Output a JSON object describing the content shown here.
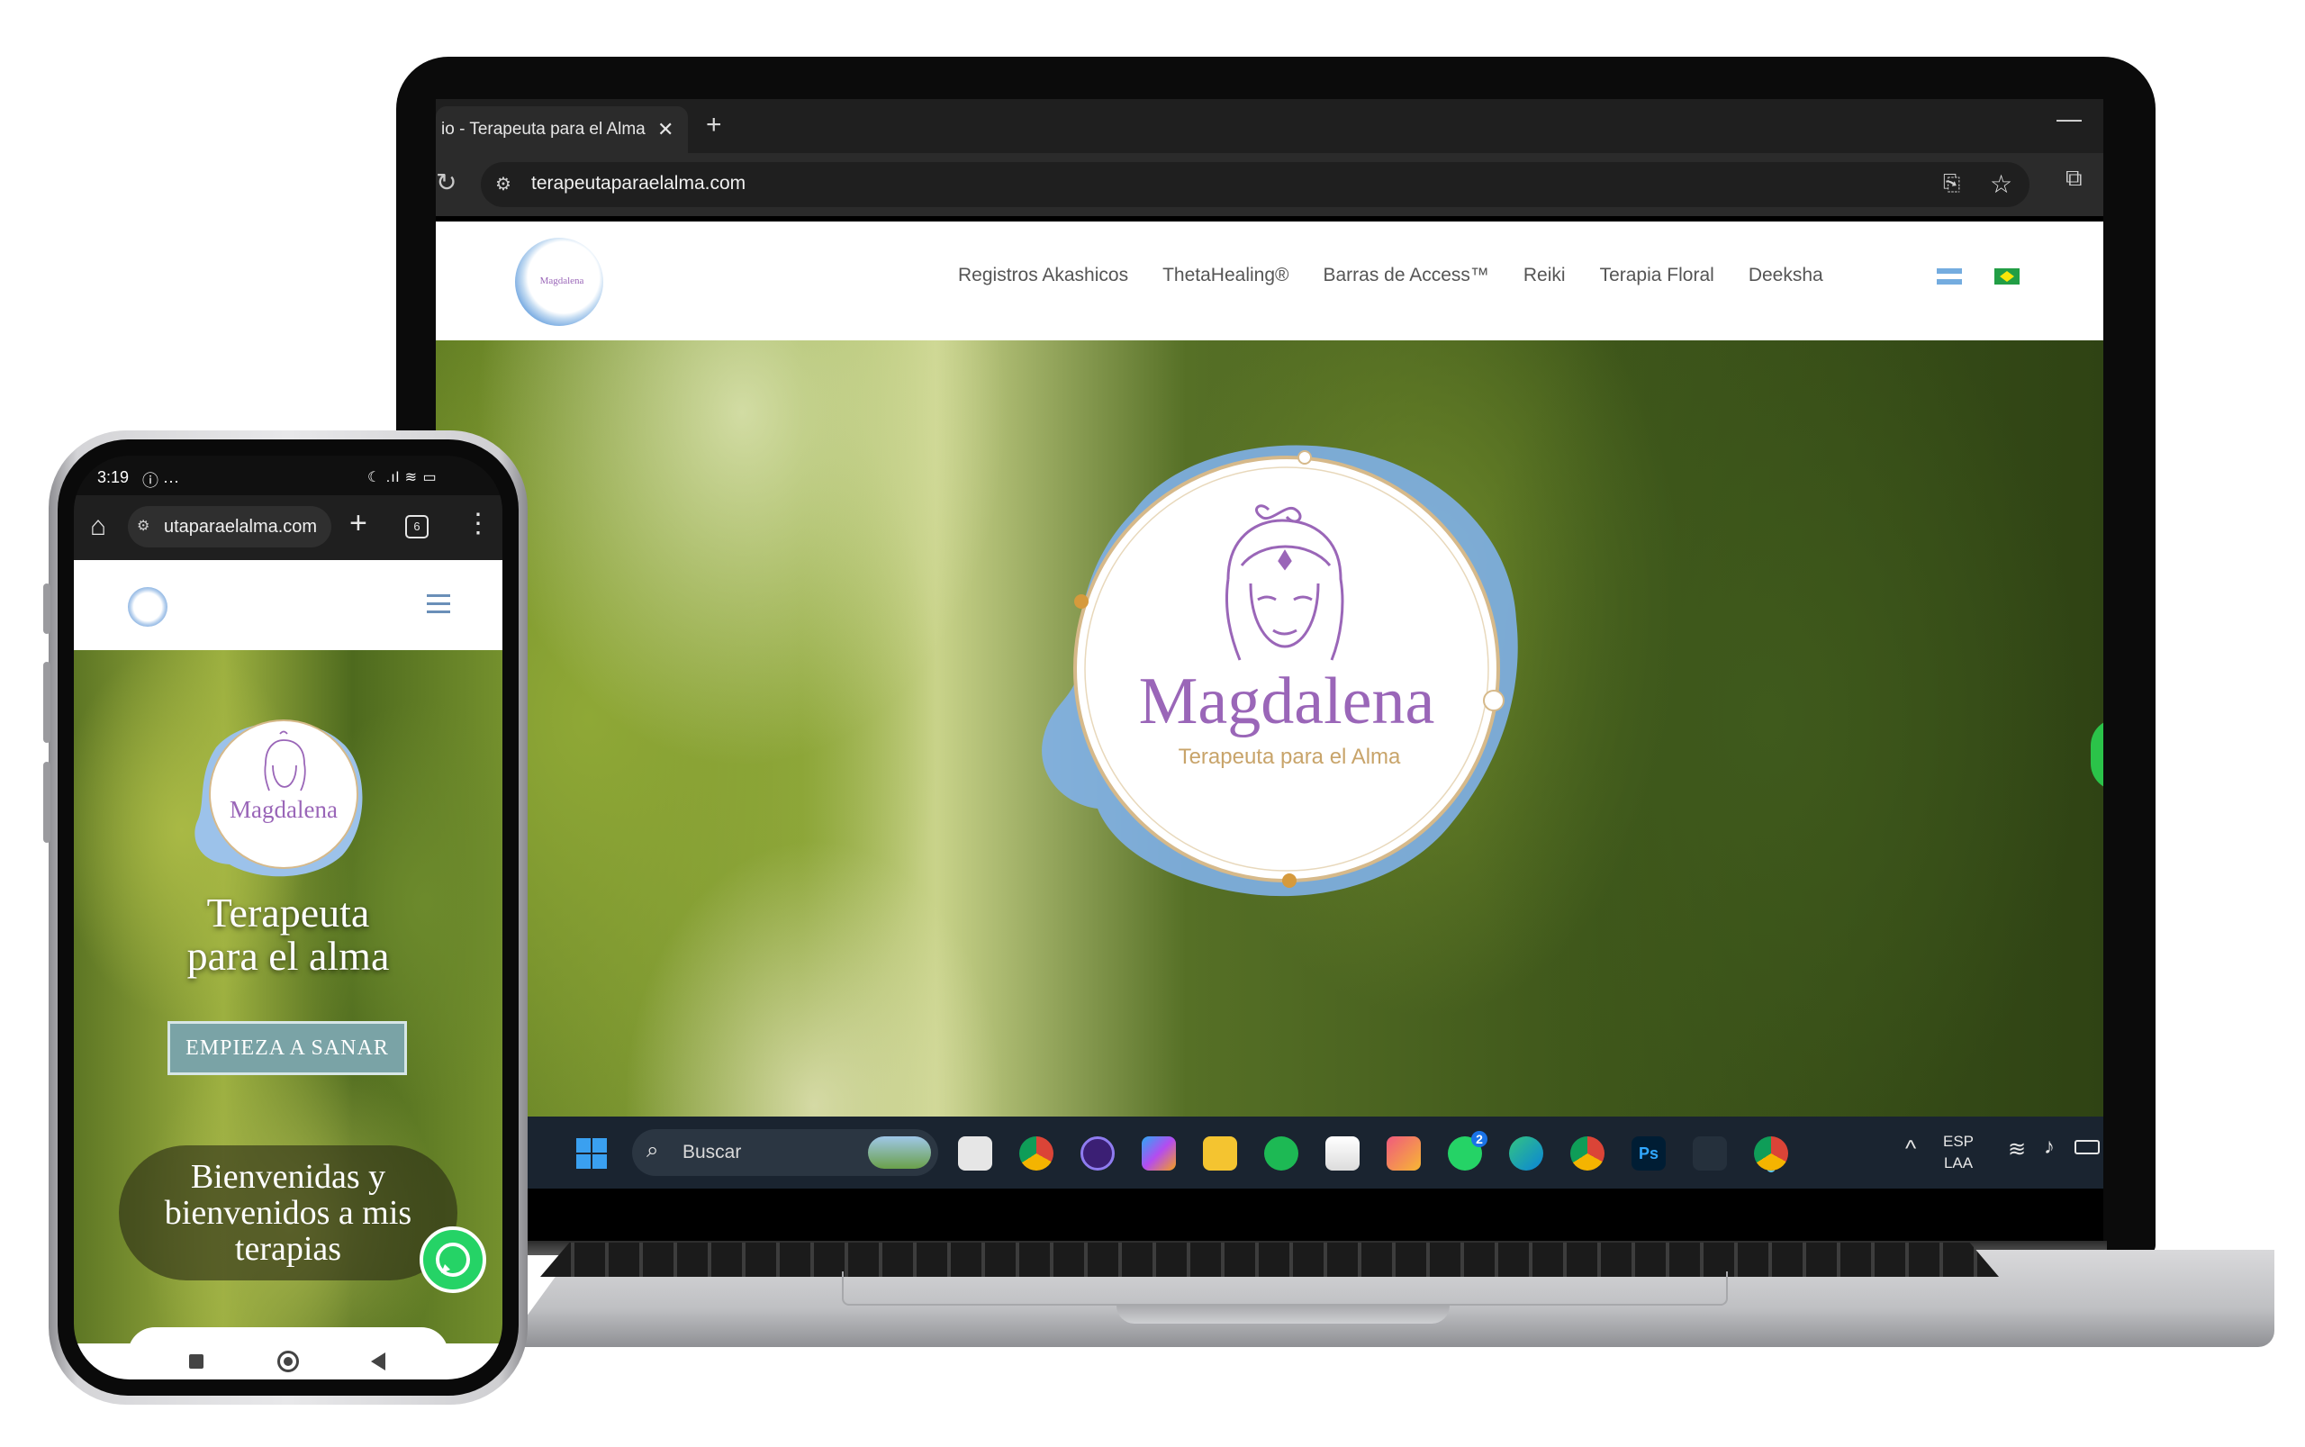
{
  "laptop": {
    "browser": {
      "tab_title": "io - Terapeuta para el Alma",
      "tab_close": "✕",
      "new_tab": "+",
      "minimize": "—",
      "reload": "↻",
      "site_info": "⚙",
      "url": "terapeutaparaelalma.com",
      "translate": "⎘",
      "bookmark": "☆",
      "extensions": "⧉"
    },
    "site": {
      "logo_text": "Magdalena",
      "nav": [
        "Registros Akashicos",
        "ThetaHealing®",
        "Barras de Access™",
        "Reiki",
        "Terapia Floral",
        "Deeksha"
      ],
      "hero_logo": {
        "name": "Magdalena",
        "tagline": "Terapeuta para el Alma"
      }
    },
    "taskbar": {
      "search_placeholder": "Buscar",
      "search_glyph": "⌕",
      "apps": [
        "task-view",
        "chrome",
        "cortana",
        "copilot",
        "explorer",
        "spotify",
        "store",
        "camera",
        "whatsapp",
        "edge",
        "chrome-profile",
        "photoshop",
        "terminal",
        "chrome-active"
      ],
      "whatsapp_badge": "2",
      "photoshop_label": "Ps",
      "tray_up": "^",
      "lang_line1": "ESP",
      "lang_line2": "LAA",
      "wifi": "≋",
      "volume": "♪"
    },
    "colors": {
      "nav_text": "#555555",
      "taskbar": "#1a2430",
      "brand_purple": "#9a66b8",
      "brand_gold": "#c8a46a"
    }
  },
  "phone": {
    "status": {
      "time": "3:19",
      "extra": "ⓘ ···",
      "right": "☾ .ıl ≋ ▭"
    },
    "browser": {
      "home": "⌂",
      "site_info": "⚙",
      "url": "utaparaelalma.com",
      "new_tab": "+",
      "tab_count": "6",
      "menu": "⋮"
    },
    "site": {
      "logo_text": "Magdalena",
      "hero_title_line1": "Terapeuta",
      "hero_title_line2": "para el alma",
      "cta": "EMPIEZA A SANAR",
      "welcome_line1": "Bienvenidas y",
      "welcome_line2": "bienvenidos a mis",
      "welcome_line3": "terapias"
    }
  }
}
